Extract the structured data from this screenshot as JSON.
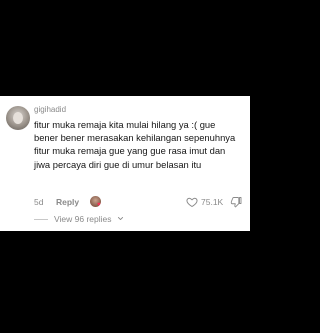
{
  "comment": {
    "username": "gigihadid",
    "text": "fitur muka remaja kita mulai hilang ya :( gue bener bener merasakan kehilangan sepenuhnya fitur muka remaja gue yang gue rasa imut dan jiwa percaya diri gue di umur belasan itu",
    "timestamp": "5d",
    "reply_label": "Reply",
    "like_count": "75.1K",
    "view_replies_label": "View 96 replies"
  },
  "colors": {
    "background": "#000000",
    "card": "#ffffff",
    "text": "#161616",
    "muted": "#8a8a8a",
    "heart_accent": "#fe2c55"
  },
  "icons": {
    "like": "heart-outline-icon",
    "dislike": "thumbs-down-icon",
    "expand": "chevron-down-icon",
    "creator_liked": "creator-heart-icon"
  }
}
